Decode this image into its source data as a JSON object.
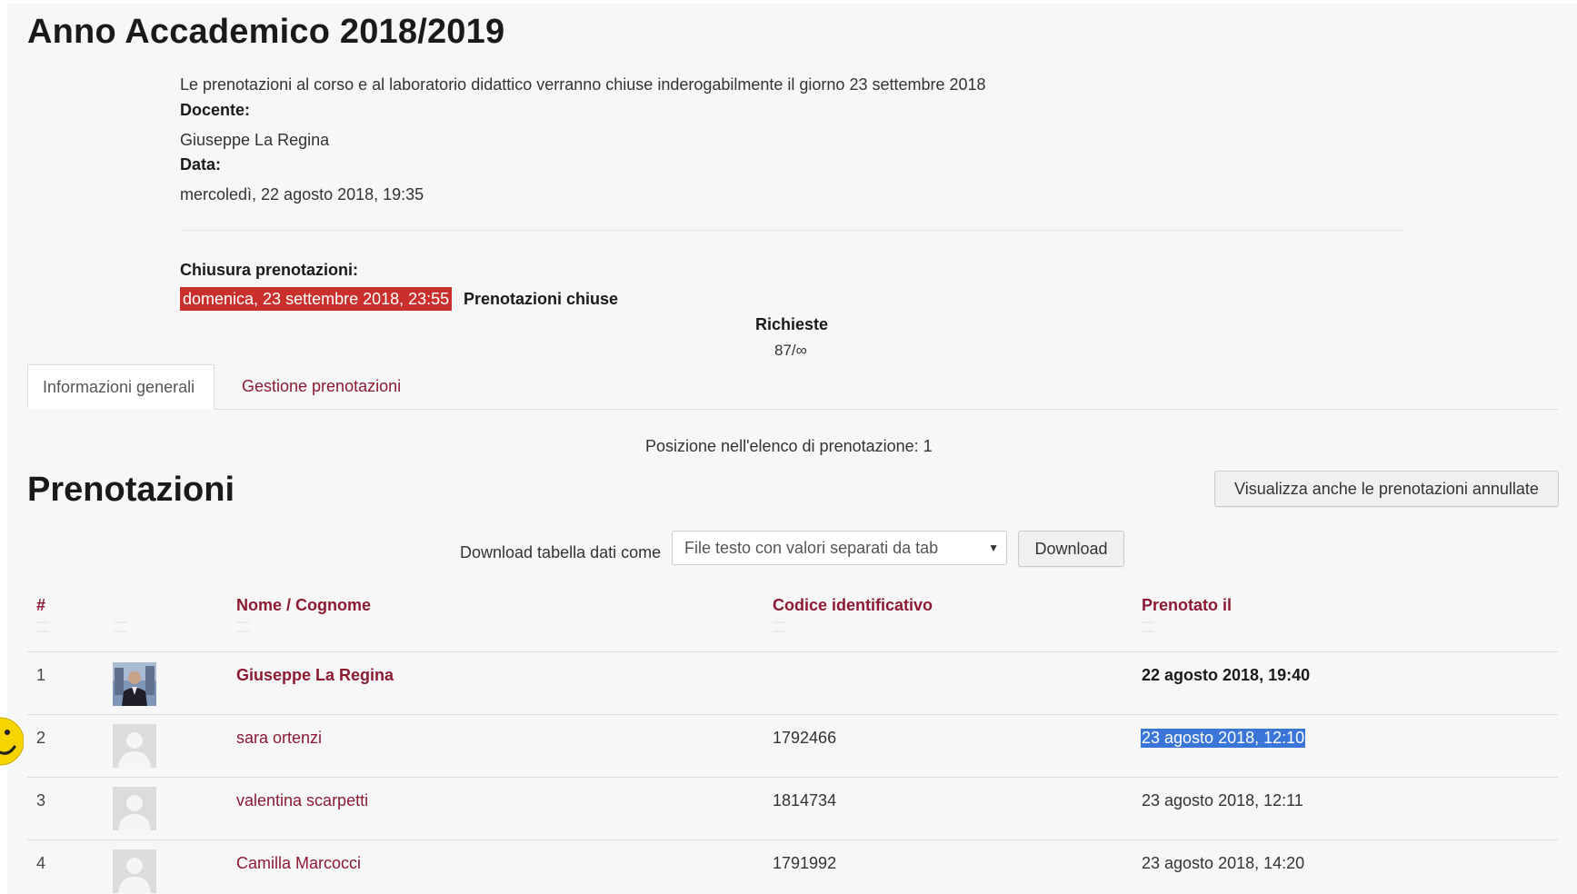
{
  "header": {
    "title": "Anno Accademico 2018/2019",
    "notice": "Le prenotazioni al corso e al laboratorio didattico verranno chiuse inderogabilmente il giorno 23 settembre 2018",
    "docente_label": "Docente:",
    "docente_value": "Giuseppe La Regina",
    "data_label": "Data:",
    "data_value": "mercoledì, 22 agosto 2018, 19:35",
    "closure_label": "Chiusura prenotazioni:",
    "closure_date": "domenica, 23 settembre 2018, 23:55",
    "closure_status": "Prenotazioni chiuse",
    "closure_date_color": "#c9302c",
    "requests_label": "Richieste",
    "requests_value": "87/∞"
  },
  "tabs": [
    {
      "label": "Informazioni generali",
      "active": true
    },
    {
      "label": "Gestione prenotazioni",
      "active": false
    }
  ],
  "position_text": "Posizione nell'elenco di prenotazione: 1",
  "bookings": {
    "title": "Prenotazioni",
    "show_cancelled_button": "Visualizza anche le prenotazioni annullate",
    "download_label": "Download tabella dati come",
    "download_format": "File testo con valori separati da tab",
    "download_button": "Download",
    "columns": {
      "num": "#",
      "name": "Nome / Cognome",
      "code": "Codice identificativo",
      "date": "Prenotato il"
    },
    "rows": [
      {
        "num": "1",
        "name": "Giuseppe La Regina",
        "code": "",
        "date": "22 agosto 2018, 19:40",
        "avatar": "photo"
      },
      {
        "num": "2",
        "name": "sara ortenzi",
        "code": "1792466",
        "date": "23 agosto 2018, 12:10",
        "avatar": "default"
      },
      {
        "num": "3",
        "name": "valentina scarpetti",
        "code": "1814734",
        "date": "23 agosto 2018, 12:11",
        "avatar": "default"
      },
      {
        "num": "4",
        "name": "Camilla Marcocci",
        "code": "1791992",
        "date": "23 agosto 2018, 14:20",
        "avatar": "default"
      }
    ]
  },
  "colors": {
    "link": "#8b1a32",
    "selection": "#3a75d8"
  }
}
